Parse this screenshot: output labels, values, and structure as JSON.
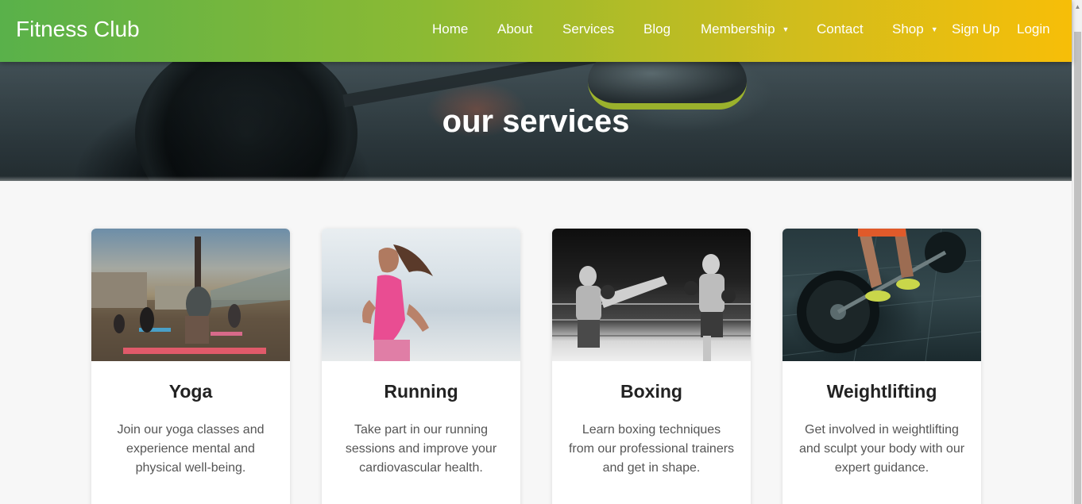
{
  "nav": {
    "brand": "Fitness Club",
    "links": [
      {
        "label": "Home",
        "dropdown": false
      },
      {
        "label": "About",
        "dropdown": false
      },
      {
        "label": "Services",
        "dropdown": false
      },
      {
        "label": "Blog",
        "dropdown": false
      },
      {
        "label": "Membership",
        "dropdown": true
      },
      {
        "label": "Contact",
        "dropdown": false
      },
      {
        "label": "Shop",
        "dropdown": true
      },
      {
        "label": "Sign Up",
        "dropdown": false
      },
      {
        "label": "Login",
        "dropdown": false
      }
    ],
    "dropdown_glyph": "▼"
  },
  "hero": {
    "title": "our services"
  },
  "services": [
    {
      "title": "Yoga",
      "description": "Join our yoga classes and experience mental and physical well-being.",
      "image": "yoga-photo"
    },
    {
      "title": "Running",
      "description": "Take part in our running sessions and improve your cardiovascular health.",
      "image": "running-photo"
    },
    {
      "title": "Boxing",
      "description": "Learn boxing techniques from our professional trainers and get in shape.",
      "image": "boxing-photo"
    },
    {
      "title": "Weightlifting",
      "description": "Get involved in weightlifting and sculpt your body with our expert guidance.",
      "image": "weightlifting-photo"
    }
  ],
  "colors": {
    "nav_gradient_start": "#59b14a",
    "nav_gradient_end": "#f7be08",
    "nav_text": "#ffffff",
    "card_title": "#222222",
    "card_text": "#555555"
  }
}
